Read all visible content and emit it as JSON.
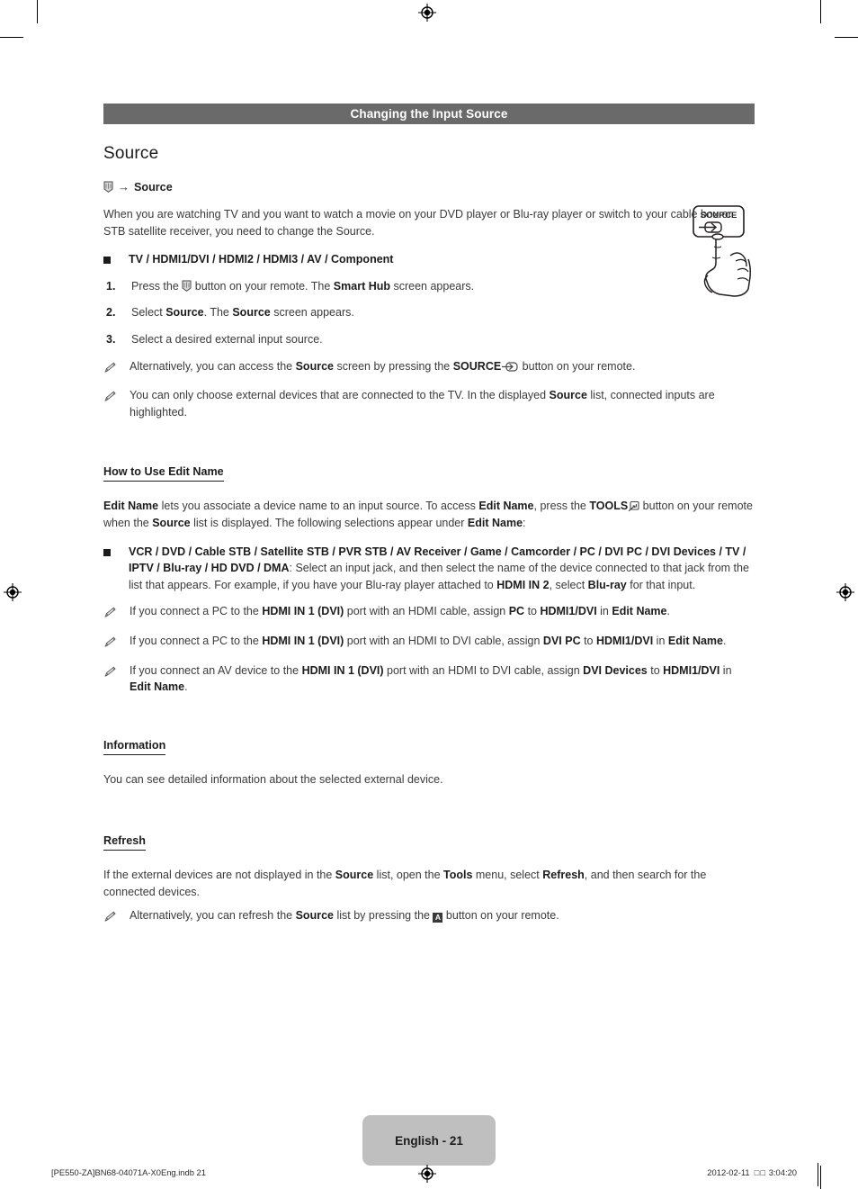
{
  "banner": {
    "title": "Changing the Input Source"
  },
  "section": {
    "title": "Source",
    "path": {
      "icon": "smart-hub-icon",
      "arrow": "→",
      "label": "Source"
    },
    "intro": "When you are watching TV and you want to watch a movie on your DVD player or Blu-ray player or switch to your cable box or STB satellite receiver, you need to change the Source.",
    "inputs_bullet": {
      "bold_list": "TV / HDMI1/DVI / HDMI2 / HDMI3 / AV / Component"
    },
    "steps": [
      {
        "number": "1.",
        "pre": "Press the ",
        "icon": "smart-hub-icon",
        "mid": " button on your remote. The ",
        "bold": "Smart Hub",
        "post": " screen appears."
      },
      {
        "number": "2.",
        "pre": "Select ",
        "bold1": "Source",
        "mid": ". The ",
        "bold2": "Source",
        "post": " screen appears."
      },
      {
        "number": "3.",
        "pre": "Select a desired external input source."
      }
    ],
    "notes": [
      {
        "icon": "pencil-note-icon",
        "pre": "Alternatively, you can access the ",
        "bold1": "Source",
        "mid": " screen by pressing the ",
        "bold2": "SOURCE",
        "icon2": "source-button-icon",
        "post": " button on your remote."
      },
      {
        "icon": "pencil-note-icon",
        "pre": "You can only choose external devices that are connected to the TV. In the displayed ",
        "bold1": "Source",
        "post": " list, connected inputs are highlighted."
      }
    ]
  },
  "edit_name": {
    "heading": "How to Use Edit Name",
    "paragraph": {
      "bold1": "Edit Name",
      "t1": " lets you associate a device name to an input source. To access ",
      "bold2": "Edit Name",
      "t2": ", press the ",
      "bold3": "TOOLS",
      "icon": "tools-button-icon",
      "t3": " button on your remote when the ",
      "bold4": "Source",
      "t4": " list is displayed. The following selections appear under ",
      "bold5": "Edit Name",
      "t5": ":"
    },
    "device_bullet": {
      "bold_list": "VCR / DVD / Cable STB / Satellite STB / PVR STB / AV Receiver / Game / Camcorder / PC / DVI PC / DVI Devices / TV / IPTV / Blu-ray / HD DVD / DMA",
      "t1": ": Select an input jack, and then select the name of the device connected to that jack from the list that appears. For example, if you have your Blu-ray player attached to ",
      "bold2": "HDMI IN 2",
      "t2": ", select ",
      "bold3": "Blu-ray",
      "t3": " for that input."
    },
    "notes": [
      {
        "icon": "pencil-note-icon",
        "t1": "If you connect a PC to the ",
        "b1": "HDMI IN 1 (DVI)",
        "t2": " port with an HDMI cable, assign ",
        "b2": "PC",
        "t3": " to ",
        "b3": "HDMI1/DVI",
        "t4": " in ",
        "b4": "Edit Name",
        "t5": "."
      },
      {
        "icon": "pencil-note-icon",
        "t1": "If you connect a PC to the ",
        "b1": "HDMI IN 1 (DVI)",
        "t2": " port with an HDMI to DVI cable, assign ",
        "b2": "DVI PC",
        "t3": " to ",
        "b3": "HDMI1/DVI",
        "t4": " in ",
        "b4": "Edit Name",
        "t5": "."
      },
      {
        "icon": "pencil-note-icon",
        "t1": "If you connect an AV device to the ",
        "b1": "HDMI IN 1 (DVI)",
        "t2": " port with an HDMI to DVI cable, assign ",
        "b2": "DVI Devices",
        "t3": " to ",
        "b3": "HDMI1/DVI",
        "t4": " in ",
        "b4": "Edit Name",
        "t5": "."
      }
    ]
  },
  "information": {
    "heading": "Information",
    "paragraph": "You can see detailed information about the selected external device."
  },
  "refresh": {
    "heading": "Refresh",
    "paragraph": {
      "t1": "If the external devices are not displayed in the ",
      "b1": "Source",
      "t2": " list, open the ",
      "b2": "Tools",
      "t3": " menu, select ",
      "b3": "Refresh",
      "t4": ", and then search for the connected devices."
    },
    "note": {
      "icon": "pencil-note-icon",
      "t1": "Alternatively, you can refresh the ",
      "b1": "Source",
      "t2": " list by pressing the ",
      "b2": "A",
      "t3": " button on your remote."
    }
  },
  "illustration": {
    "name": "remote-source-button-hand",
    "button_label": "SOURCE"
  },
  "footer": {
    "page_label": "English - 21",
    "file_ref": "[PE550-ZA]BN68-04071A-X0Eng.indb   21",
    "date": "2012-02-11",
    "missing_glyphs": "□□",
    "time": "3:04:20"
  },
  "colors": {
    "banner_bg": "#6a6a6a",
    "page_pill_bg": "#bfbfbf",
    "text": "#3a3a3a",
    "bold_text": "#1c1c1c"
  }
}
